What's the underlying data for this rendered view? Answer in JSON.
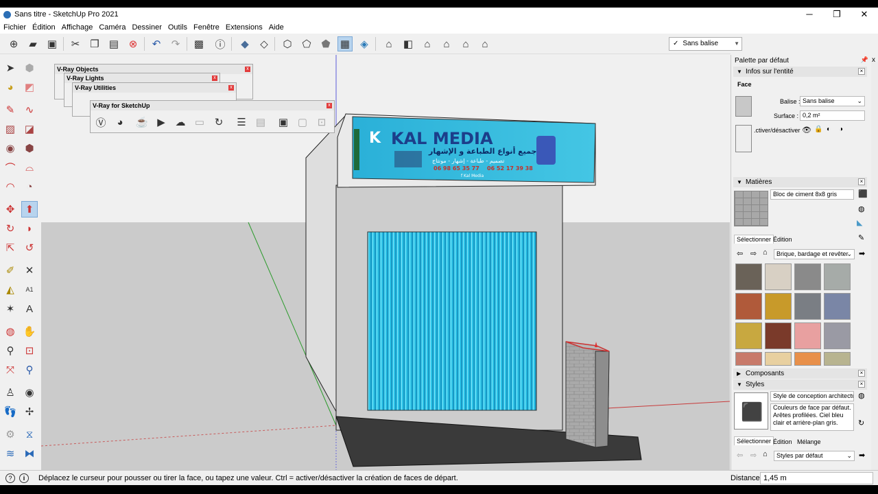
{
  "window": {
    "title": "Sans titre - SketchUp Pro 2021",
    "minimize": "─",
    "maximize": "❐",
    "close": "✕"
  },
  "menu": [
    "Fichier",
    "Édition",
    "Affichage",
    "Caméra",
    "Dessiner",
    "Outils",
    "Fenêtre",
    "Extensions",
    "Aide"
  ],
  "toolbar": {
    "tag_selector": "Sans balise",
    "tag_check": "✓"
  },
  "vray_panels": {
    "objects": "V-Ray Objects",
    "lights": "V-Ray Lights",
    "utilities": "V-Ray Utilities",
    "main": "V-Ray for SketchUp",
    "close": "x"
  },
  "sign": {
    "brand": "KAL MEDIA",
    "arabic_title": "جميع أنواع الطباعة و الإشهار",
    "arabic_sub": "تصميم - طباعة - إشهار - مونتاج",
    "phone1": "06 98 65 35 77",
    "phone2": "06 52 17 39 38",
    "social": "f Kal Media"
  },
  "tray": {
    "title": "Palette par défaut",
    "pin": "ꟷ",
    "close": "x",
    "entity": {
      "header": "Infos sur l'entité",
      "type": "Face",
      "tag_label": "Balise :",
      "tag_value": "Sans balise",
      "area_label": "Surface :",
      "area_value": "0,2 m²",
      "toggle_label": ".ctiver/désactiver"
    },
    "materials": {
      "header": "Matières",
      "name": "Bloc de ciment 8x8 gris",
      "tab_select": "Sélectionner",
      "tab_edit": "Édition",
      "library": "Brique, bardage et revêter"
    },
    "components": {
      "header": "Composants"
    },
    "styles": {
      "header": "Styles",
      "name": "Style de conception architectur",
      "description": "Couleurs de face par défaut. Arêtes profilées. Ciel bleu clair et arrière-plan gris.",
      "tab_select": "Sélectionner",
      "tab_edit": "Édition",
      "tab_mix": "Mélange",
      "library": "Styles par défaut"
    }
  },
  "status": {
    "message": "Déplacez le curseur pour pousser ou tirer la face, ou tapez une valeur.  Ctrl = activer/désactiver la création de faces de départ.",
    "distance_label": "Distance",
    "distance_value": "1,45 m"
  },
  "colors": {
    "sign_bg": "#2fb5d6",
    "shutter": "#2bc4e8",
    "brand_blue": "#1c3e8a",
    "selection_blue": "#b8d4ee"
  }
}
